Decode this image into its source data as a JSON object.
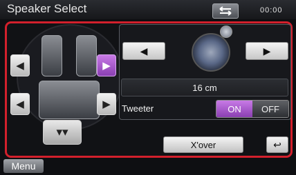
{
  "header": {
    "title": "Speaker Select",
    "clock": "00:00",
    "back_icon": "back-arrows-icon"
  },
  "speakers": {
    "front_left": {
      "icon": "speaker-left-icon",
      "glyph": "◀",
      "state": "inactive"
    },
    "front_right": {
      "icon": "speaker-right-icon",
      "glyph": "▶",
      "state": "selected"
    },
    "rear_left": {
      "icon": "speaker-left-icon",
      "glyph": "◀",
      "state": "inactive"
    },
    "rear_right": {
      "icon": "speaker-right-icon",
      "glyph": "▶",
      "state": "inactive"
    },
    "subwoofer": {
      "icon": "subwoofer-icon",
      "glyph": "▾▾",
      "state": "inactive"
    }
  },
  "panel": {
    "prev_glyph": "◀",
    "next_glyph": "▶",
    "speaker_size": "16 cm",
    "tweeter_label": "Tweeter",
    "tweeter_on": "ON",
    "tweeter_off": "OFF",
    "tweeter_state": "ON"
  },
  "buttons": {
    "xover": "X'over",
    "return_glyph": "↩"
  },
  "footer": {
    "menu": "Menu"
  },
  "colors": {
    "accent_selected": "#a855d1",
    "frame_border": "#d3202c"
  }
}
